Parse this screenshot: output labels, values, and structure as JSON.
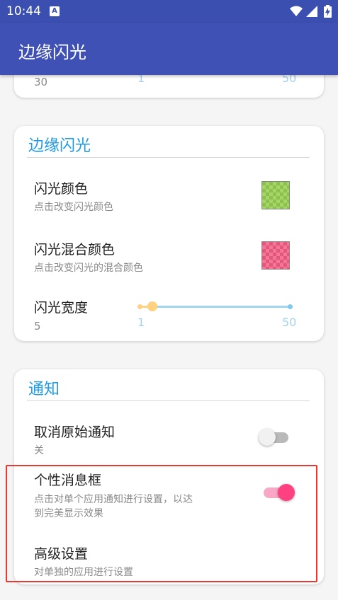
{
  "status_bar": {
    "time": "10:44",
    "a_badge": "A"
  },
  "app_bar": {
    "title": "边缘闪光"
  },
  "top_card": {
    "value": "30",
    "slider_min": "1",
    "slider_max": "50"
  },
  "flash_card": {
    "header": "边缘闪光",
    "flash_color": {
      "title": "闪光颜色",
      "summary": "点击改变闪光颜色",
      "color": "#8bc34a"
    },
    "mix_color": {
      "title": "闪光混合颜色",
      "summary": "点击改变闪光的混合颜色",
      "color": "#e8557a"
    },
    "width": {
      "title": "闪光宽度",
      "value": "5",
      "slider_min": "1",
      "slider_max": "50",
      "slider_fraction": 0.08
    }
  },
  "notify_card": {
    "header": "通知",
    "cancel_original": {
      "title": "取消原始通知",
      "summary": "关",
      "enabled": false
    },
    "custom_bubble": {
      "title": "个性消息框",
      "summary_line1": "点击对单个应用通知进行设置，以达",
      "summary_line2": "到完美显示效果",
      "enabled": true
    },
    "advanced": {
      "title": "高级设置",
      "summary": "对单独的应用进行设置"
    }
  },
  "colors": {
    "primary": "#3f51b5",
    "accent": "#ff4081",
    "header_blue": "#1e9be8",
    "highlight": "#e53935"
  }
}
